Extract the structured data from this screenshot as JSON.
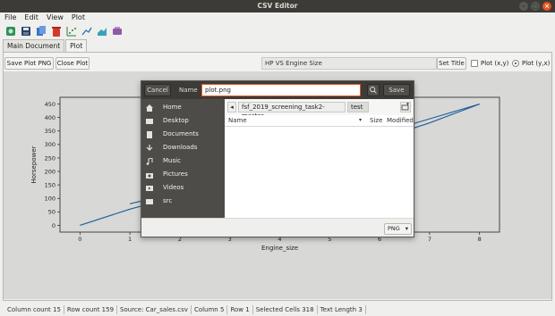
{
  "window": {
    "title": "CSV Editor"
  },
  "menu": [
    "File",
    "Edit",
    "View",
    "Plot"
  ],
  "toolbar": {
    "icons": [
      "open-file-icon",
      "save-icon",
      "copy-icon",
      "delete-icon",
      "scatter-plot-icon",
      "line-plot-icon",
      "area-plot-icon",
      "settings-icon"
    ]
  },
  "tabs": [
    "Main Document",
    "Plot"
  ],
  "active_tab": "Plot",
  "plot_controls": {
    "save_label": "Save Plot PNG",
    "close_label": "Close Plot",
    "title_value": "HP VS Engine Size",
    "set_title_label": "Set Title",
    "option_xy": "Plot (x,y)",
    "option_yx": "Plot (y,x)",
    "selected_option": "Plot (y,x)"
  },
  "chart_data": {
    "type": "line",
    "xlabel": "Engine_size",
    "ylabel": "Horsepower",
    "xlim": [
      -0.4,
      8.4
    ],
    "ylim": [
      -25,
      475
    ],
    "x_ticks": [
      "0",
      "1",
      "2",
      "3",
      "4",
      "5",
      "6",
      "7",
      "8"
    ],
    "y_ticks": [
      "0",
      "50",
      "100",
      "150",
      "200",
      "250",
      "300",
      "350",
      "400",
      "450"
    ],
    "series": [
      {
        "x": [
          0,
          1,
          2,
          3,
          4,
          5,
          6,
          7,
          8
        ],
        "y": [
          0,
          60,
          110,
          165,
          220,
          270,
          320,
          380,
          450
        ]
      },
      {
        "x": [
          1,
          2,
          3,
          4,
          5,
          6,
          7,
          8
        ],
        "y": [
          80,
          125,
          180,
          230,
          290,
          340,
          395,
          450
        ]
      }
    ],
    "color": "#1f5f99"
  },
  "dialog": {
    "cancel_label": "Cancel",
    "name_label": "Name",
    "filename": "plot.png",
    "save_label": "Save",
    "places": [
      {
        "label": "Home",
        "icon": "home-icon"
      },
      {
        "label": "Desktop",
        "icon": "folder-icon"
      },
      {
        "label": "Documents",
        "icon": "document-icon"
      },
      {
        "label": "Downloads",
        "icon": "download-icon"
      },
      {
        "label": "Music",
        "icon": "music-icon"
      },
      {
        "label": "Pictures",
        "icon": "camera-icon"
      },
      {
        "label": "Videos",
        "icon": "video-icon"
      },
      {
        "label": "src",
        "icon": "folder-icon"
      }
    ],
    "path": [
      "fsf_2019_screening_task2-master",
      "test"
    ],
    "columns": {
      "name": "Name",
      "size": "Size",
      "modified": "Modified"
    },
    "file_type": "PNG"
  },
  "status": {
    "column_count": "Column count 15",
    "row_count": "Row count 159",
    "source": "Source: Car_sales.csv",
    "column": "Column 5",
    "row": "Row 1",
    "selected": "Selected Cells 318",
    "text_length": "Text Length 3"
  }
}
